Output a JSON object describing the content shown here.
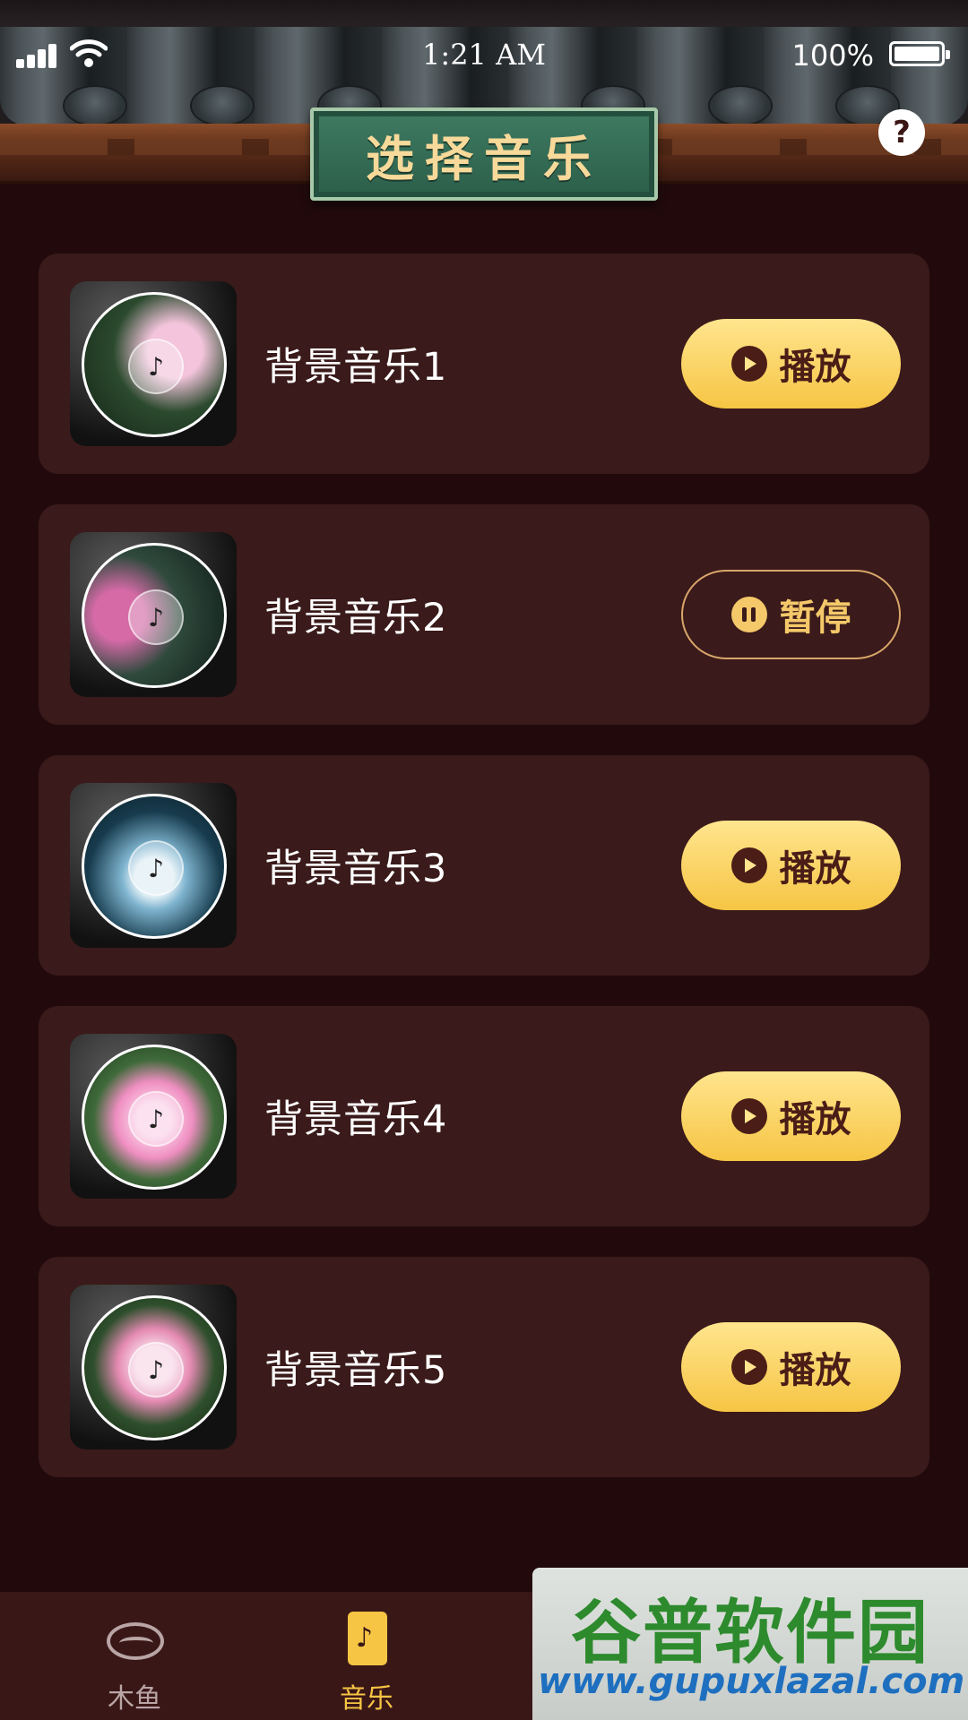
{
  "status_bar": {
    "time": "1:21 AM",
    "battery": "100%"
  },
  "header": {
    "title": "选择音乐",
    "help": "?"
  },
  "tracks": [
    {
      "title": "背景音乐1",
      "button": "播放",
      "state": "play",
      "art_color": "#e6a3c8"
    },
    {
      "title": "背景音乐2",
      "button": "暂停",
      "state": "pause",
      "art_color": "#d56aa7"
    },
    {
      "title": "背景音乐3",
      "button": "播放",
      "state": "play",
      "art_color": "#a9d4ea"
    },
    {
      "title": "背景音乐4",
      "button": "播放",
      "state": "play",
      "art_color": "#ef8ec1"
    },
    {
      "title": "背景音乐5",
      "button": "播放",
      "state": "play",
      "art_color": "#e58bb3"
    }
  ],
  "tabs": [
    {
      "label": "木鱼",
      "icon": "wooden-fish-icon",
      "active": false
    },
    {
      "label": "音乐",
      "icon": "music-note-icon",
      "active": true
    }
  ],
  "watermark": {
    "name": "谷普软件园",
    "url": "www.gupuxlazal.com"
  },
  "colors": {
    "accent": "#f6c544",
    "background": "#220a0c",
    "card": "#3a1a1a"
  }
}
